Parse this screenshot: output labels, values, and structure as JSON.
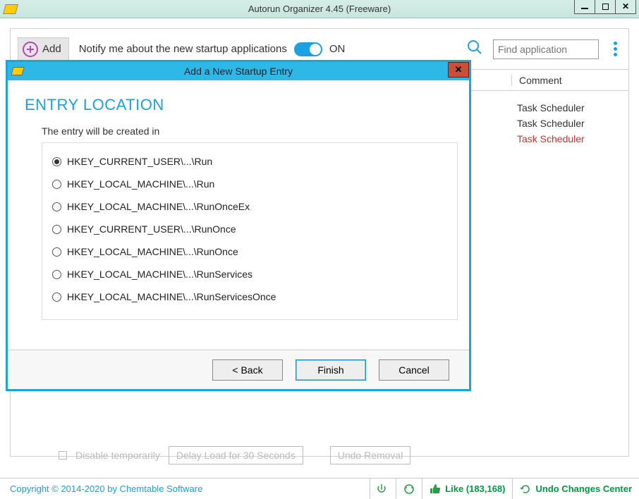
{
  "window": {
    "title": "Autorun Organizer 4.45 (Freeware)"
  },
  "toolbar": {
    "add_label": "Add",
    "notify_label": "Notify me about the new startup applications",
    "toggle_label": "ON",
    "search_placeholder": "Find application"
  },
  "table": {
    "comment_header": "Comment",
    "rows": [
      {
        "comment": "Task Scheduler",
        "highlight": false
      },
      {
        "comment": "Task Scheduler",
        "highlight": false
      },
      {
        "comment": "Task Scheduler",
        "highlight": true
      }
    ]
  },
  "bottom_peek": {
    "disable_label": "Disable temporarily",
    "delay_label": "Delay Load for 30 Seconds",
    "undo_label": "Undo Removal"
  },
  "dialog": {
    "title": "Add a New Startup Entry",
    "heading": "ENTRY LOCATION",
    "group_label": "The entry will be created in",
    "options": [
      "HKEY_CURRENT_USER\\...\\Run",
      "HKEY_LOCAL_MACHINE\\...\\Run",
      "HKEY_LOCAL_MACHINE\\...\\RunOnceEx",
      "HKEY_CURRENT_USER\\...\\RunOnce",
      "HKEY_LOCAL_MACHINE\\...\\RunOnce",
      "HKEY_LOCAL_MACHINE\\...\\RunServices",
      "HKEY_LOCAL_MACHINE\\...\\RunServicesOnce"
    ],
    "selected_index": 0,
    "back_label": "< Back",
    "finish_label": "Finish",
    "cancel_label": "Cancel"
  },
  "statusbar": {
    "copyright": "Copyright © 2014-2020 by Chemtable Software",
    "like_label": "Like (183,168)",
    "undo_label": "Undo Changes Center"
  }
}
